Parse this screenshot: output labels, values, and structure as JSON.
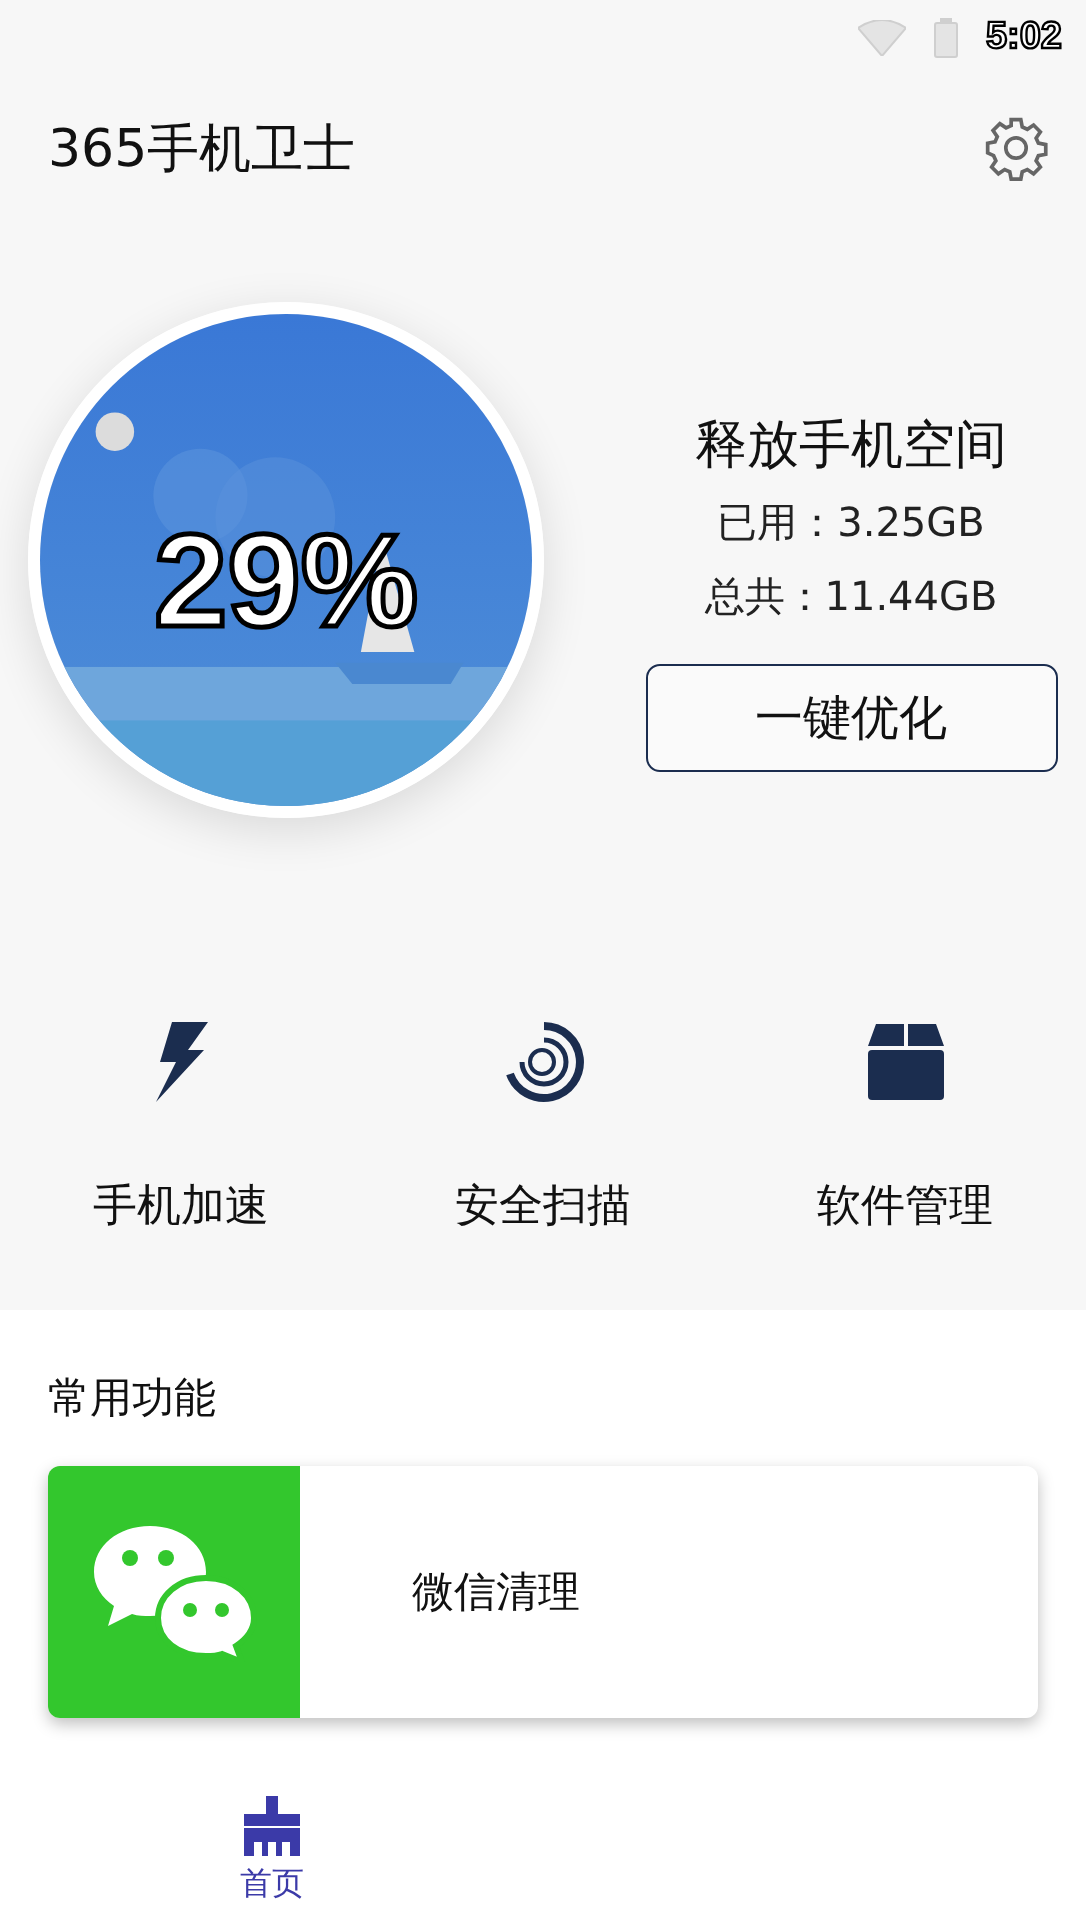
{
  "status_bar": {
    "time": "5:02"
  },
  "header": {
    "title": "365手机卫士"
  },
  "storage": {
    "percent": "29%",
    "heading": "释放手机空间",
    "used": "已用：3.25GB",
    "total": "总共：11.44GB",
    "button": "一键优化"
  },
  "features": [
    {
      "kind": "bolt",
      "label": "手机加速"
    },
    {
      "kind": "scan",
      "label": "安全扫描"
    },
    {
      "kind": "box",
      "label": "软件管理"
    }
  ],
  "common": {
    "title": "常用功能",
    "items": [
      {
        "kind": "wechat",
        "label": "微信清理"
      }
    ]
  },
  "nav": [
    {
      "kind": "broom",
      "label": "首页",
      "selected": true
    }
  ]
}
